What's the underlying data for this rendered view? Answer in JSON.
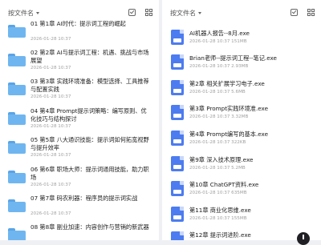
{
  "left": {
    "sort_label": "按文件名",
    "folders": [
      {
        "name": "01 第1章 AI时代：提示词工程的崛起",
        "time": "2026-01-28 10:37"
      },
      {
        "name": "02 第2章 AI与提示词工程：机遇、挑战与市场展望",
        "time": "2026-01-28 10:37"
      },
      {
        "name": "03 第3章 实践环境准备：模型选择、工具推荐与配置实践",
        "time": "2026-01-28 10:37"
      },
      {
        "name": "04 第4章 Prompt提示词策略：编写原则、优化技巧与结构探讨",
        "time": "2026-01-28 10:37"
      },
      {
        "name": "05 第5章 八大通识技能：提示词如何拓宽视野与提升效率",
        "time": "2026-01-28 10:37"
      },
      {
        "name": "06 第6章 职场大师：提示词通用技能，助力职场",
        "time": "2026-01-28 10:37"
      },
      {
        "name": "07 第7章 码农利器：程序员的提示词实战",
        "time": "2026-01-28 10:37"
      },
      {
        "name": "08 第8章 副业加速：内容创作与营销的新武器",
        "time": "2026-01-28 10:37"
      }
    ]
  },
  "right": {
    "sort_label": "按文件名",
    "files": [
      {
        "name": "AI机器人报告--8月.exe",
        "meta": "2026-01-28 10:37  151MB"
      },
      {
        "name": "Brian老师--提示词工程--笔记.exe",
        "meta": "2026-01-28 10:37  2.93MB"
      },
      {
        "name": "第2章 相关扩展学习电子.exe",
        "meta": "2026-01-28 10:37  5.6MB"
      },
      {
        "name": "第3章 Prompt实践环境准.exe",
        "meta": "2026-01-28 10:37  3.32MB"
      },
      {
        "name": "第4章 Prompt编写的基本.exe",
        "meta": "2026-01-28 10:37  322KB"
      },
      {
        "name": "第9章 深入技术原理.exe",
        "meta": "2026-01-28 10:37  5.2MB"
      },
      {
        "name": "第10章 ChatGPT资料.exe",
        "meta": "2026-01-28 10:37  635MB"
      },
      {
        "name": "第11章 商业化思维.exe",
        "meta": "2026-01-28 10:37  155MB"
      },
      {
        "name": "第12章 提示词进阶.exe",
        "meta": ""
      }
    ]
  }
}
